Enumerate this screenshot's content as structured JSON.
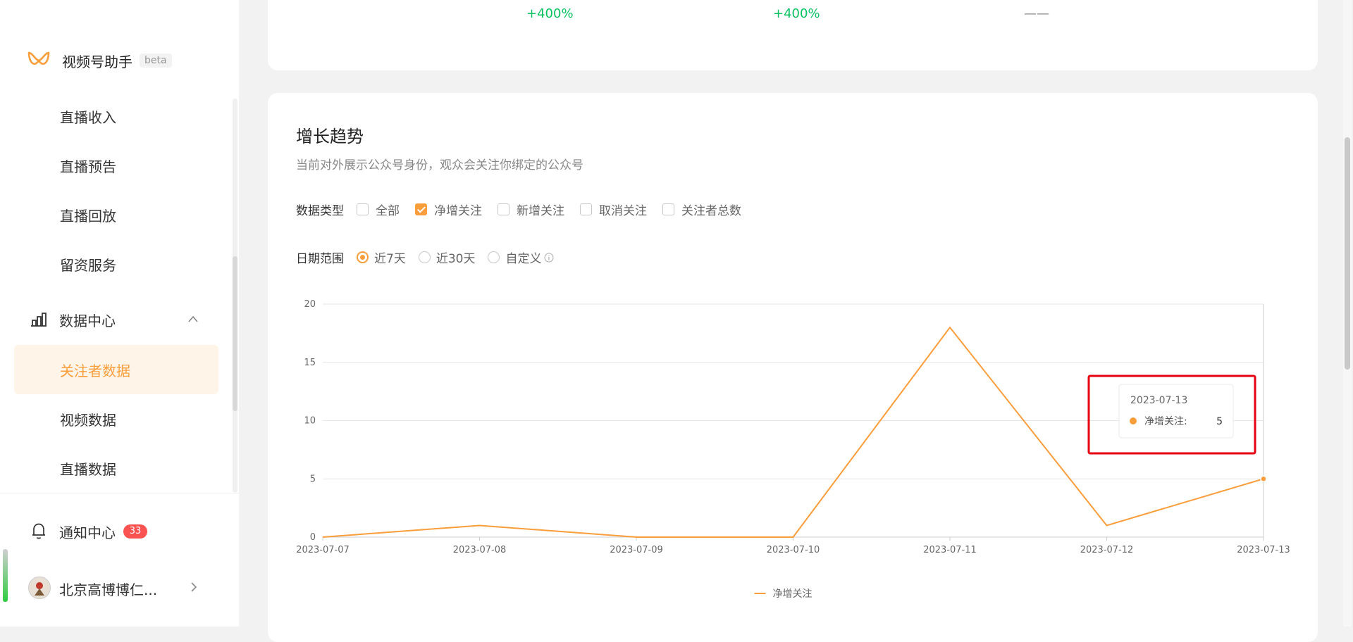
{
  "sidebar": {
    "app_name": "视频号助手",
    "beta": "beta",
    "items_live": [
      "直播收入",
      "直播预告",
      "直播回放",
      "留资服务"
    ],
    "data_center": {
      "label": "数据中心",
      "items": [
        "关注者数据",
        "视频数据",
        "直播数据"
      ],
      "active_index": 0
    },
    "notification": {
      "label": "通知中心",
      "badge": "33"
    },
    "account": {
      "label": "北京高博博仁..."
    }
  },
  "top_stats": [
    "+400%",
    "+400%",
    "——"
  ],
  "growth": {
    "title": "增长趋势",
    "desc": "当前对外展示公众号身份，观众会关注你绑定的公众号",
    "data_type": {
      "label": "数据类型",
      "options": [
        "全部",
        "净增关注",
        "新增关注",
        "取消关注",
        "关注者总数"
      ],
      "checked": [
        false,
        true,
        false,
        false,
        false
      ]
    },
    "date_range": {
      "label": "日期范围",
      "options": [
        "近7天",
        "近30天",
        "自定义"
      ],
      "selected": 0
    }
  },
  "chart_data": {
    "type": "line",
    "x": [
      "2023-07-07",
      "2023-07-08",
      "2023-07-09",
      "2023-07-10",
      "2023-07-11",
      "2023-07-12",
      "2023-07-13"
    ],
    "series": [
      {
        "name": "净增关注",
        "values": [
          0,
          1,
          0,
          0,
          18,
          1,
          5
        ],
        "color": "#fa9d3b"
      }
    ],
    "ylim": [
      0,
      20
    ],
    "yticks": [
      0,
      5,
      10,
      15,
      20
    ],
    "grid": true,
    "legend": "bottom-center",
    "tooltip": {
      "date": "2023-07-13",
      "label": "净增关注:",
      "value": "5"
    }
  },
  "colors": {
    "accent": "#fa9d3b",
    "green": "#07c160",
    "badge": "#fa5151",
    "highlight": "#e60012"
  }
}
